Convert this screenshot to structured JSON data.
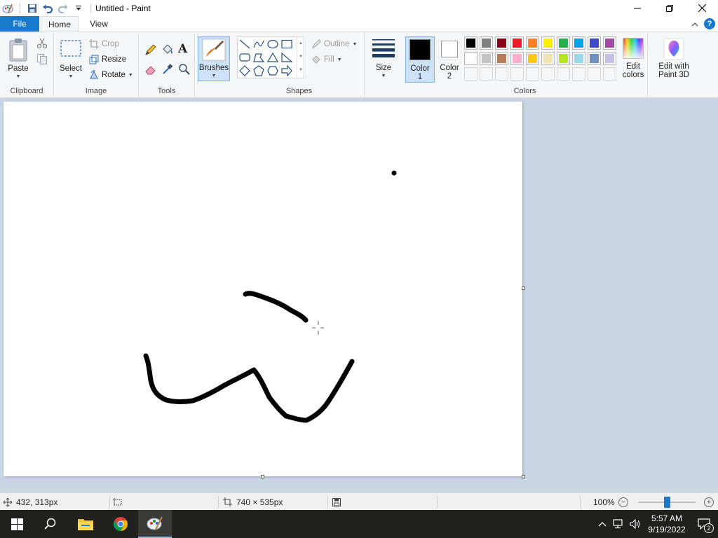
{
  "window": {
    "title": "Untitled - Paint"
  },
  "tabs": {
    "file": "File",
    "home": "Home",
    "view": "View"
  },
  "ribbon": {
    "clipboard": {
      "label": "Clipboard",
      "paste": "Paste"
    },
    "image": {
      "label": "Image",
      "select": "Select",
      "crop": "Crop",
      "resize": "Resize",
      "rotate": "Rotate"
    },
    "tools": {
      "label": "Tools"
    },
    "brushes": {
      "label": "Brushes"
    },
    "shapes": {
      "label": "Shapes",
      "outline": "Outline",
      "fill": "Fill"
    },
    "size": {
      "label": "Size"
    },
    "color1": {
      "label_line1": "Color",
      "label_line2": "1",
      "value": "#000000"
    },
    "color2": {
      "label_line1": "Color",
      "label_line2": "2",
      "value": "#ffffff"
    },
    "colors": {
      "label": "Colors",
      "row1": [
        "#000000",
        "#7f7f7f",
        "#880015",
        "#ed1c24",
        "#ff7f27",
        "#fff200",
        "#22b14c",
        "#00a2e8",
        "#3f48cc",
        "#a349a4"
      ],
      "row2": [
        "#ffffff",
        "#c3c3c3",
        "#b97a57",
        "#ffaec9",
        "#ffc90e",
        "#efe4b0",
        "#b5e61d",
        "#99d9ea",
        "#7092be",
        "#c8bfe7"
      ]
    },
    "edit_colors": {
      "line1": "Edit",
      "line2": "colors"
    },
    "paint3d": {
      "line1": "Edit with",
      "line2": "Paint 3D"
    }
  },
  "status": {
    "cursor_pos": "432, 313px",
    "image_size": "740 × 535px",
    "zoom": "100%",
    "zoom_level": 0.5
  },
  "taskbar": {
    "time": "5:57 AM",
    "date": "9/19/2022",
    "notifications": "2"
  }
}
